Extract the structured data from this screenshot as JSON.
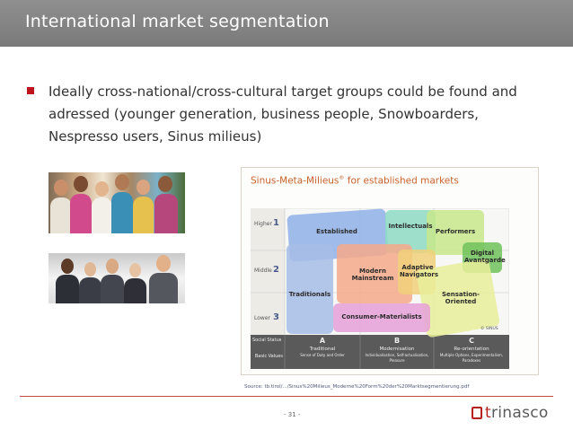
{
  "slide": {
    "title": "International market segmentation",
    "bullet": "Ideally cross-national/cross-cultural target groups could be found and adressed (younger generation, business people, Snowboarders, Nespresso users, Sinus milieus)",
    "source": "Source: tb.tirol/.../Sinus%20Milieus_Moderne%20Form%20der%20Marktsegmentierung.pdf",
    "page_number": "- 31 -",
    "logo": {
      "prefix": "t",
      "rest": "rinasco"
    }
  },
  "figure": {
    "title": "Sinus-Meta-Milieus",
    "title_mark": "®",
    "title_suffix": " for established markets",
    "rows": [
      {
        "label": "Higher",
        "num": "1"
      },
      {
        "label": "Middle",
        "num": "2"
      },
      {
        "label": "Lower",
        "num": "3"
      }
    ],
    "corner_label": "Social Status",
    "values_label": "Basic Values",
    "columns": [
      {
        "letter": "A",
        "name": "Traditional",
        "desc": "Sense of Duty and Order"
      },
      {
        "letter": "B",
        "name": "Modernisation",
        "desc": "Individualisation, Self-actualisation, Pleasure"
      },
      {
        "letter": "C",
        "name": "Re-orientation",
        "desc": "Multiple Options, Experimentalism, Paradoxes"
      }
    ],
    "milieus": {
      "established": "Established",
      "intellectuals": "Intellectuals",
      "performers": "Performers",
      "digital": "Digital Avantgarde",
      "modern": "Modern Mainstream",
      "adaptive": "Adaptive Navigators",
      "sensation": "Sensation-Oriented",
      "traditionals": "Traditionals",
      "consumer": "Consumer-Materialists"
    },
    "watermark": "© SINUS"
  },
  "colors": {
    "title_bar": "#858585",
    "bullet": "#c0141c",
    "accent": "#b8221e",
    "figure_title": "#c7622c"
  }
}
